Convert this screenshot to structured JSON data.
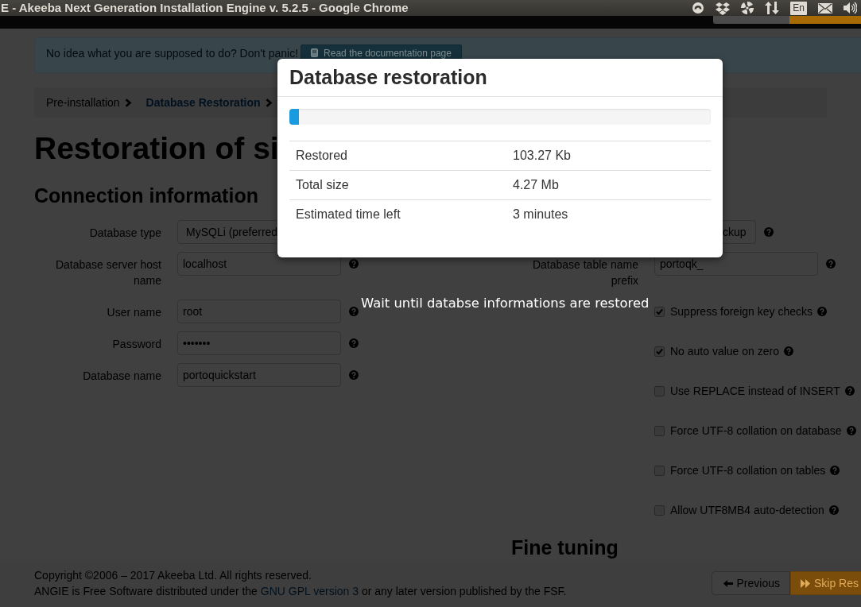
{
  "title_bar": {
    "title": "E - Akeeba Next Generation Installation Engine v. 5.2.5 - Google Chrome",
    "keyboard_layout": "En"
  },
  "help_banner": {
    "text": "No idea what you are supposed to do? Don't panic!",
    "button": "Read the documentation page"
  },
  "breadcrumb": [
    {
      "label": "Pre-installation",
      "selected": false
    },
    {
      "label": "Database Restoration",
      "selected": true
    }
  ],
  "page_title": "Restoration of si",
  "connection": {
    "heading": "Connection information",
    "fields": [
      {
        "label": "Database type",
        "value": "MySQLi (preferred",
        "kind": "select",
        "help": false
      },
      {
        "label": "Database server host name",
        "value": "localhost",
        "kind": "text",
        "help": true
      },
      {
        "label": "User name",
        "value": "root",
        "kind": "text",
        "help": true
      },
      {
        "label": "Password",
        "value": "•••••••",
        "kind": "password",
        "help": true
      },
      {
        "label": "Database name",
        "value": "portoquickstart",
        "kind": "text",
        "help": true
      }
    ]
  },
  "options": {
    "button": {
      "label": "ckup",
      "help": true
    },
    "fields": [
      {
        "label": "Database table name prefix",
        "value": "portoqk_",
        "kind": "text",
        "help": true
      }
    ],
    "checkboxes": [
      {
        "label": "Suppress foreign key checks",
        "checked": true
      },
      {
        "label": "No auto value on zero",
        "checked": true
      },
      {
        "label": "Use REPLACE instead of INSERT",
        "checked": false
      },
      {
        "label": "Force UTF-8 collation on database",
        "checked": false
      },
      {
        "label": "Force UTF-8 collation on tables",
        "checked": false
      },
      {
        "label": "Allow UTF8MB4 auto-detection",
        "checked": false
      }
    ],
    "heading": "Fine tuning"
  },
  "dialog": {
    "title": "Database restoration",
    "progress": {
      "level": 0.022
    },
    "rows": [
      {
        "label": "Restored",
        "value": "103.27 Kb"
      },
      {
        "label": "Total size",
        "value": "4.27 Mb"
      },
      {
        "label": "Estimated time left",
        "value": "3 minutes"
      }
    ]
  },
  "overlay_message": "Wait until databse informations are restored",
  "footer": {
    "copyright": "Copyright ©2006 – 2017 Akeeba Ltd. All rights reserved.",
    "license_text": "ANGIE is Free Software distributed under the",
    "license_link": "GNU GPL version 3",
    "license_end": "or any later version published by the FSF.",
    "buttons": [
      {
        "label": "Previous",
        "kind": "previous"
      },
      {
        "label": "Skip Res",
        "kind": "skip"
      }
    ]
  }
}
